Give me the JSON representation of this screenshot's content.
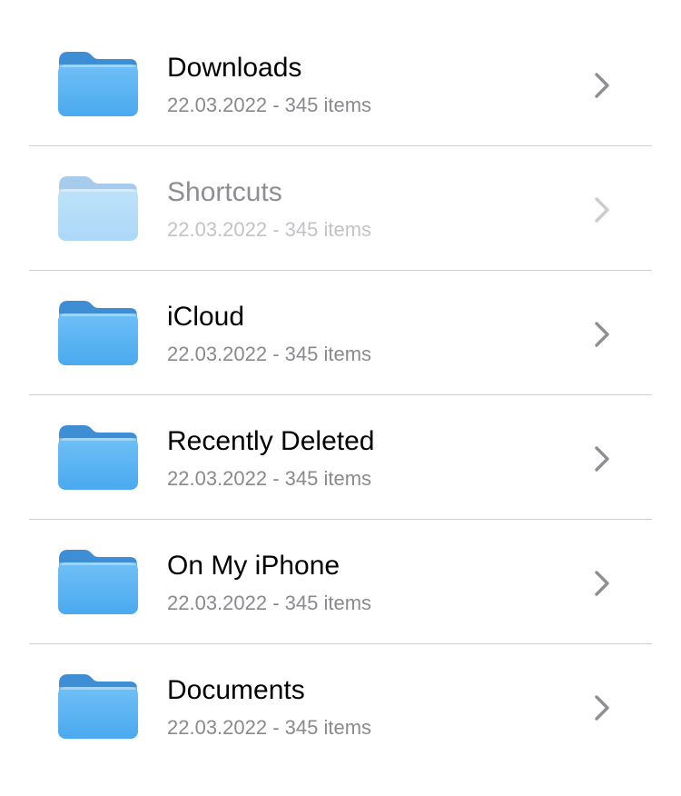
{
  "colors": {
    "folder_top": "#6fc0f6",
    "folder_bottom": "#4aa9ef",
    "folder_tab": "#3d8ed4",
    "title_text": "#000000",
    "subtitle_text": "#8a8a8e",
    "chevron": "#8e8e93",
    "divider": "#cfcfcf"
  },
  "folders": [
    {
      "name": "Downloads",
      "meta": "22.03.2022 - 345 items",
      "icon": "folder-icon",
      "state": "normal"
    },
    {
      "name": "Shortcuts",
      "meta": "22.03.2022 - 345 items",
      "icon": "folder-icon",
      "state": "disabled"
    },
    {
      "name": "iCloud",
      "meta": "22.03.2022 - 345 items",
      "icon": "folder-icon",
      "state": "normal"
    },
    {
      "name": "Recently Deleted",
      "meta": "22.03.2022 - 345 items",
      "icon": "folder-icon",
      "state": "normal"
    },
    {
      "name": "On My iPhone",
      "meta": "22.03.2022 - 345 items",
      "icon": "folder-icon",
      "state": "normal"
    },
    {
      "name": "Documents",
      "meta": "22.03.2022 - 345 items",
      "icon": "folder-icon",
      "state": "normal"
    }
  ]
}
